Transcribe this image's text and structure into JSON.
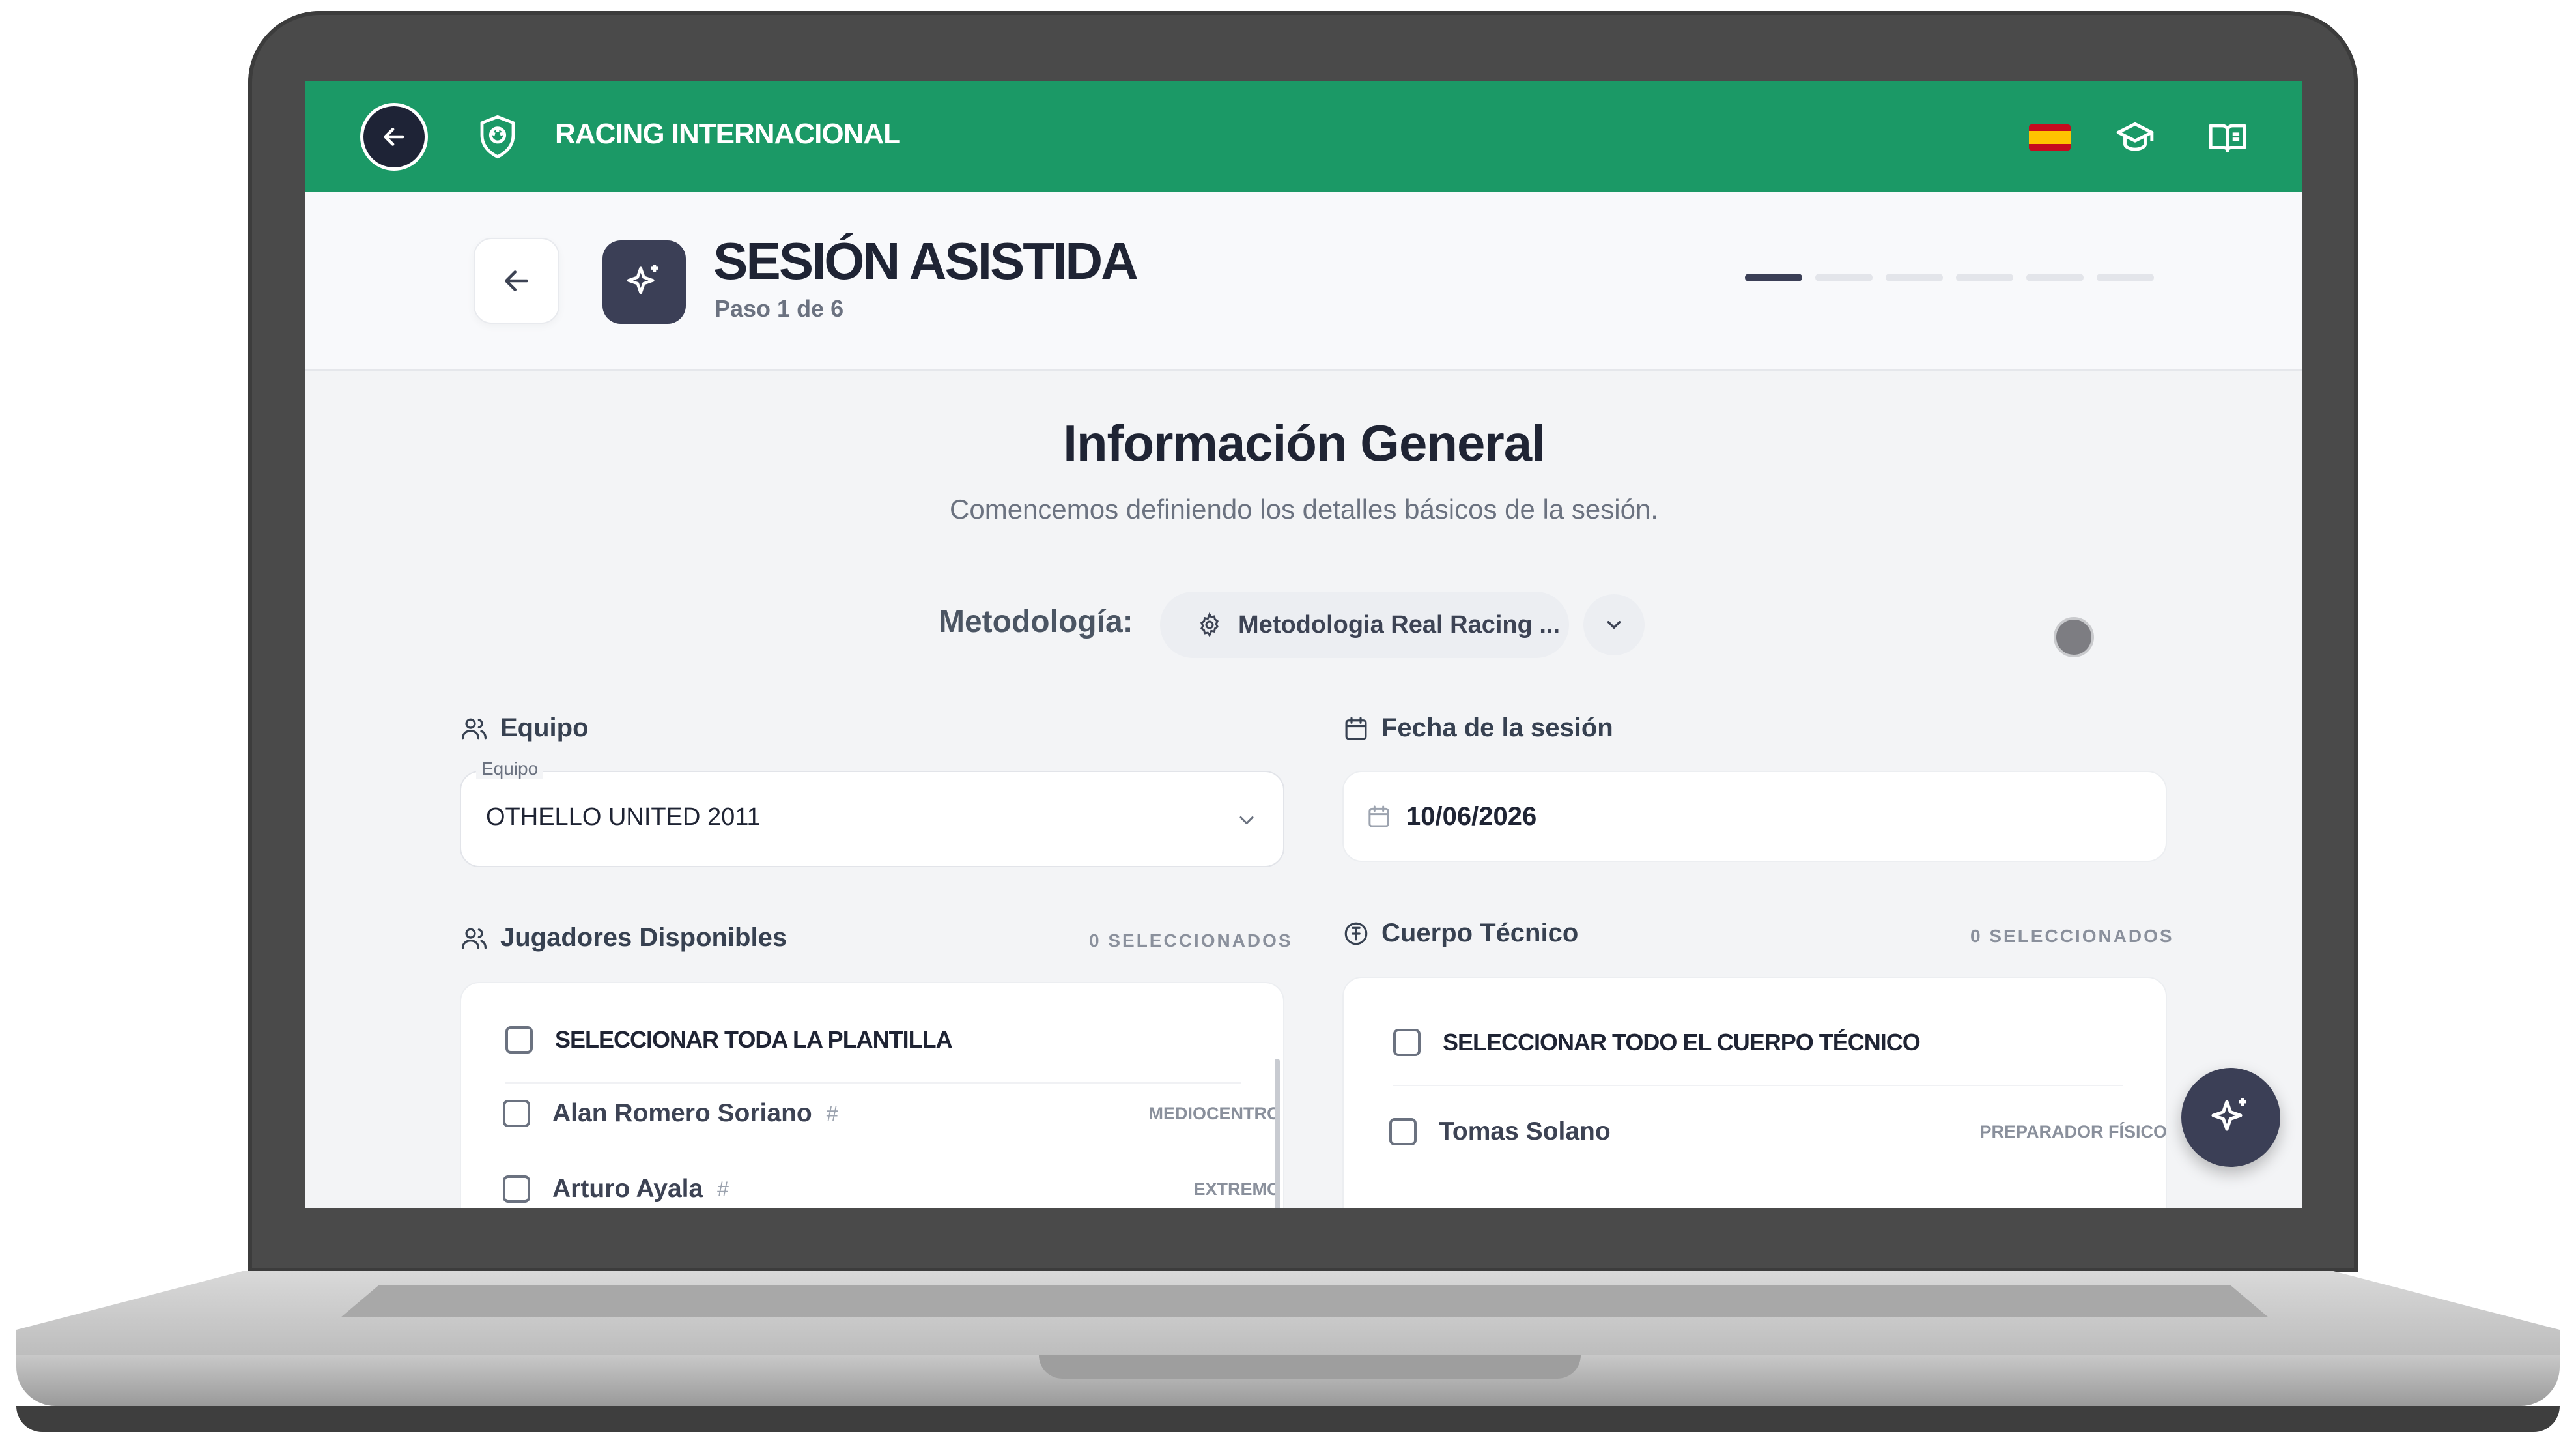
{
  "topbar": {
    "brand": "RACING INTERNACIONAL",
    "brand_color": "#1b9966",
    "icons": [
      "back-arrow-icon",
      "shield-icon",
      "spain-flag-icon",
      "graduation-cap-icon",
      "book-open-icon"
    ]
  },
  "header": {
    "title": "SESIÓN ASISTIDA",
    "step": "Paso 1 de 6",
    "progress_total": 6,
    "progress_current": 1
  },
  "section": {
    "title": "Información General",
    "subtitle": "Comencemos definiendo los detalles básicos de la sesión."
  },
  "methodology": {
    "label": "Metodología:",
    "value": "Metodologia Real Racing ..."
  },
  "team": {
    "label": "Equipo",
    "legend": "Equipo",
    "value": "OTHELLO UNITED 2011"
  },
  "date": {
    "label": "Fecha de la sesión",
    "value": "10/06/2026"
  },
  "players": {
    "label": "Jugadores Disponibles",
    "count": "0 SELECCIONADOS",
    "select_all": "SELECCIONAR TODA LA PLANTILLA",
    "items": [
      {
        "name": "Alan Romero Soriano",
        "hash": "#",
        "role": "MEDIOCENTRO"
      },
      {
        "name": "Arturo Ayala",
        "hash": "#",
        "role": "EXTREMO"
      }
    ]
  },
  "staff": {
    "label": "Cuerpo Técnico",
    "count": "0 SELECCIONADOS",
    "select_all": "SELECCIONAR TODO EL CUERPO TÉCNICO",
    "items": [
      {
        "name": "Tomas Solano",
        "role": "PREPARADOR FÍSICO"
      }
    ]
  }
}
